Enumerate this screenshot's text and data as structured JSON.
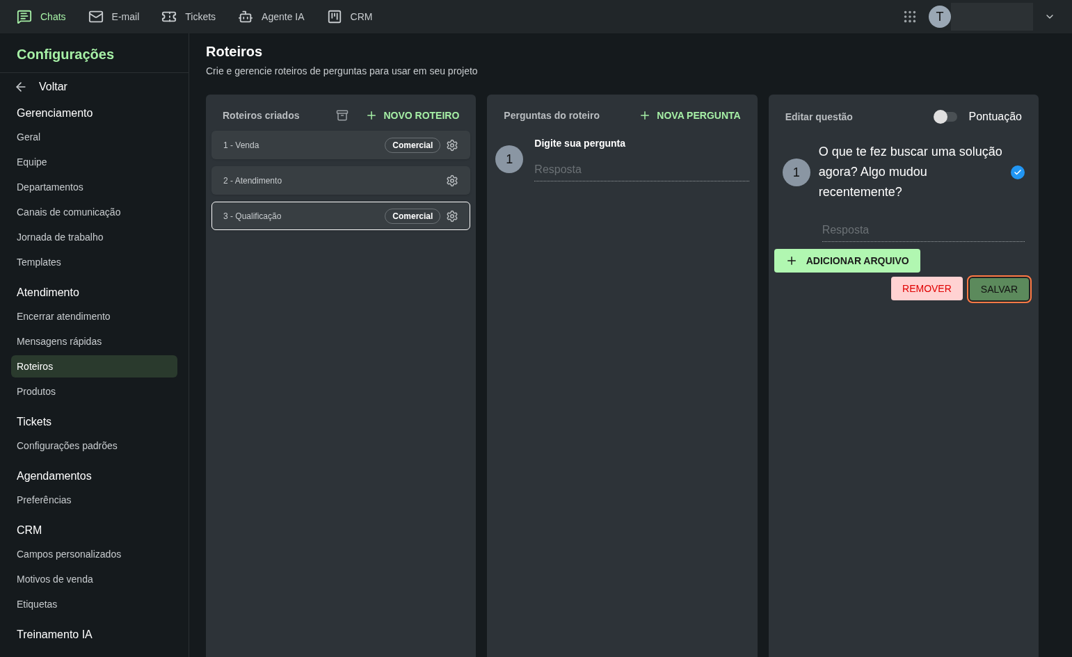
{
  "nav": [
    {
      "label": "Chats",
      "kind": "chat",
      "selected": true
    },
    {
      "label": "E-mail",
      "kind": "mail",
      "selected": false
    },
    {
      "label": "Tickets",
      "kind": "ticket",
      "selected": false
    },
    {
      "label": "Agente IA",
      "kind": "robot",
      "selected": false
    },
    {
      "label": "CRM",
      "kind": "board",
      "selected": false
    }
  ],
  "user": {
    "initial": "T"
  },
  "sidebar": {
    "title": "Configurações",
    "back": "Voltar",
    "groups": [
      {
        "title": "Gerenciamento",
        "items": [
          {
            "label": "Geral",
            "selected": false
          },
          {
            "label": "Equipe",
            "selected": false
          },
          {
            "label": "Departamentos",
            "selected": false
          },
          {
            "label": "Canais de comunicação",
            "selected": false
          },
          {
            "label": "Jornada de trabalho",
            "selected": false
          },
          {
            "label": "Templates",
            "selected": false
          }
        ]
      },
      {
        "title": "Atendimento",
        "items": [
          {
            "label": "Encerrar atendimento",
            "selected": false
          },
          {
            "label": "Mensagens rápidas",
            "selected": false
          },
          {
            "label": "Roteiros",
            "selected": true
          },
          {
            "label": "Produtos",
            "selected": false
          }
        ]
      },
      {
        "title": "Tickets",
        "items": [
          {
            "label": "Configurações padrões",
            "selected": false
          }
        ]
      },
      {
        "title": "Agendamentos",
        "items": [
          {
            "label": "Preferências",
            "selected": false
          }
        ]
      },
      {
        "title": "CRM",
        "items": [
          {
            "label": "Campos personalizados",
            "selected": false
          },
          {
            "label": "Motivos de venda",
            "selected": false
          },
          {
            "label": "Etiquetas",
            "selected": false
          }
        ]
      },
      {
        "title": "Treinamento IA"
      }
    ]
  },
  "page": {
    "title": "Roteiros",
    "subtitle": "Crie e gerencie roteiros de perguntas para usar em seu projeto"
  },
  "scripts_panel": {
    "title": "Roteiros criados",
    "new_button": "NOVO ROTEIRO",
    "scripts": [
      {
        "name": "1 - Venda",
        "tag": "Comercial",
        "selected": false
      },
      {
        "name": "2 - Atendimento",
        "selected": false
      },
      {
        "name": "3 - Qualificação",
        "tag": "Comercial",
        "selected": true
      }
    ]
  },
  "questions_panel": {
    "title": "Perguntas do roteiro",
    "new_button": "NOVA PERGUNTA",
    "questions": [
      {
        "number": "1",
        "question": "Digite sua pergunta",
        "answer_placeholder": "Resposta"
      }
    ]
  },
  "edit_panel": {
    "title": "Editar questão",
    "scoring_label": "Pontuação",
    "scoring_on": false,
    "number": "1",
    "question": "O que te fez buscar uma solução agora? Algo mudou recentemente?",
    "confirmed": true,
    "answer_placeholder": "Resposta",
    "add_file": "ADICIONAR ARQUIVO",
    "remove": "REMOVER",
    "save": "SALVAR"
  }
}
